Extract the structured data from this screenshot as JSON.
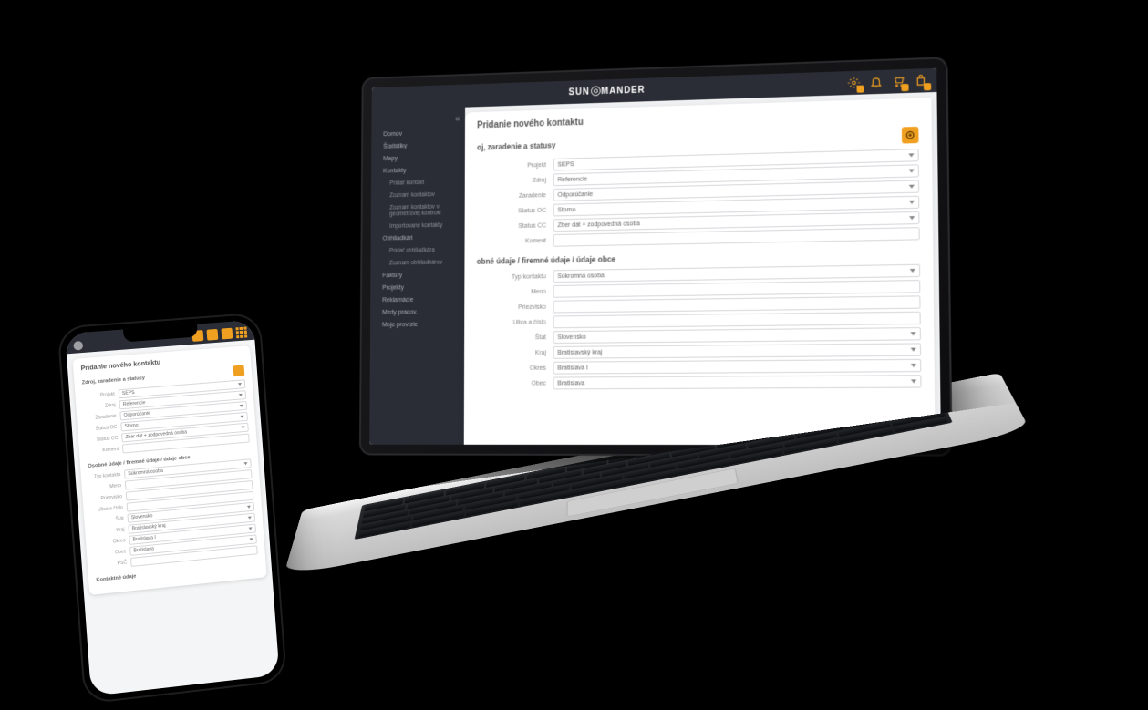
{
  "brand": {
    "left": "SUN",
    "right": "MANDER"
  },
  "header_icons": [
    "settings-icon",
    "bell-icon",
    "cart-icon",
    "bag-icon"
  ],
  "sidebar": {
    "groups": [
      {
        "label": "Domov",
        "items": []
      },
      {
        "label": "Štatistiky",
        "items": []
      },
      {
        "label": "Mapy",
        "items": []
      },
      {
        "label": "Kontakty",
        "items": [
          "Pridať kontakt",
          "Zoznam kontaktov",
          "Zoznam kontaktov v geometrovej kontrole",
          "Importované kontakty"
        ]
      },
      {
        "label": "Obhliadkári",
        "items": [
          "Pridať obhliadkára",
          "Zoznam obhliadkárov"
        ]
      },
      {
        "label": "Faktúry",
        "items": []
      },
      {
        "label": "Projekty",
        "items": []
      },
      {
        "label": "Reklamácie",
        "items": []
      },
      {
        "label": "Mzdy pracov.",
        "items": []
      },
      {
        "label": "Moje provízie",
        "items": []
      }
    ]
  },
  "page": {
    "title_full": "Pridanie nového kontaktu",
    "section1": {
      "title": "Zdroj, zaradenie a statusy",
      "title_cut": "oj, zaradenie a statusy",
      "fields": {
        "projekt": {
          "label": "Projekt",
          "value": "SEPS"
        },
        "zdroj": {
          "label": "Zdroj",
          "value": "Referencie"
        },
        "zaradenie": {
          "label": "Zaradenie",
          "value": "Odporúčanie"
        },
        "status_oc": {
          "label": "Status OC",
          "value": "Storno"
        },
        "status_cc": {
          "label": "Status CC",
          "value": "Zber dát + zodpovedná osoba"
        },
        "koment": {
          "label": "Koment",
          "value": ""
        }
      }
    },
    "section2": {
      "title": "Osobné údaje / firemné údaje / údaje obce",
      "title_cut": "obné údaje / firemné údaje / údaje obce",
      "fields": {
        "typ": {
          "label": "Typ kontaktu",
          "value": "Súkromná osoba"
        },
        "meno": {
          "label": "Meno",
          "value": ""
        },
        "priezvisko": {
          "label": "Priezvisko",
          "value": ""
        },
        "ulica": {
          "label": "Ulica a číslo",
          "value": ""
        },
        "stat": {
          "label": "Štát",
          "value": "Slovensko"
        },
        "kraj": {
          "label": "Kraj",
          "value": "Bratislavský kraj"
        },
        "okres": {
          "label": "Okres",
          "value": "Bratislava I"
        },
        "obec": {
          "label": "Obec",
          "value": "Bratislava"
        },
        "psc": {
          "label": "PSČ",
          "value": ""
        }
      }
    },
    "section3": {
      "title": "Kontaktné údaje"
    }
  }
}
